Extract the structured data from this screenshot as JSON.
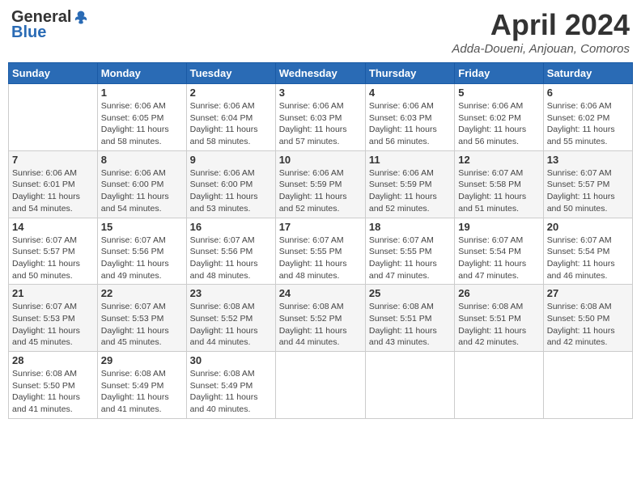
{
  "header": {
    "logo_general": "General",
    "logo_blue": "Blue",
    "title": "April 2024",
    "location": "Adda-Doueni, Anjouan, Comoros"
  },
  "days_of_week": [
    "Sunday",
    "Monday",
    "Tuesday",
    "Wednesday",
    "Thursday",
    "Friday",
    "Saturday"
  ],
  "weeks": [
    [
      {
        "day": "",
        "sunrise": "",
        "sunset": "",
        "daylight": ""
      },
      {
        "day": "1",
        "sunrise": "Sunrise: 6:06 AM",
        "sunset": "Sunset: 6:05 PM",
        "daylight": "Daylight: 11 hours and 58 minutes."
      },
      {
        "day": "2",
        "sunrise": "Sunrise: 6:06 AM",
        "sunset": "Sunset: 6:04 PM",
        "daylight": "Daylight: 11 hours and 58 minutes."
      },
      {
        "day": "3",
        "sunrise": "Sunrise: 6:06 AM",
        "sunset": "Sunset: 6:03 PM",
        "daylight": "Daylight: 11 hours and 57 minutes."
      },
      {
        "day": "4",
        "sunrise": "Sunrise: 6:06 AM",
        "sunset": "Sunset: 6:03 PM",
        "daylight": "Daylight: 11 hours and 56 minutes."
      },
      {
        "day": "5",
        "sunrise": "Sunrise: 6:06 AM",
        "sunset": "Sunset: 6:02 PM",
        "daylight": "Daylight: 11 hours and 56 minutes."
      },
      {
        "day": "6",
        "sunrise": "Sunrise: 6:06 AM",
        "sunset": "Sunset: 6:02 PM",
        "daylight": "Daylight: 11 hours and 55 minutes."
      }
    ],
    [
      {
        "day": "7",
        "sunrise": "Sunrise: 6:06 AM",
        "sunset": "Sunset: 6:01 PM",
        "daylight": "Daylight: 11 hours and 54 minutes."
      },
      {
        "day": "8",
        "sunrise": "Sunrise: 6:06 AM",
        "sunset": "Sunset: 6:00 PM",
        "daylight": "Daylight: 11 hours and 54 minutes."
      },
      {
        "day": "9",
        "sunrise": "Sunrise: 6:06 AM",
        "sunset": "Sunset: 6:00 PM",
        "daylight": "Daylight: 11 hours and 53 minutes."
      },
      {
        "day": "10",
        "sunrise": "Sunrise: 6:06 AM",
        "sunset": "Sunset: 5:59 PM",
        "daylight": "Daylight: 11 hours and 52 minutes."
      },
      {
        "day": "11",
        "sunrise": "Sunrise: 6:06 AM",
        "sunset": "Sunset: 5:59 PM",
        "daylight": "Daylight: 11 hours and 52 minutes."
      },
      {
        "day": "12",
        "sunrise": "Sunrise: 6:07 AM",
        "sunset": "Sunset: 5:58 PM",
        "daylight": "Daylight: 11 hours and 51 minutes."
      },
      {
        "day": "13",
        "sunrise": "Sunrise: 6:07 AM",
        "sunset": "Sunset: 5:57 PM",
        "daylight": "Daylight: 11 hours and 50 minutes."
      }
    ],
    [
      {
        "day": "14",
        "sunrise": "Sunrise: 6:07 AM",
        "sunset": "Sunset: 5:57 PM",
        "daylight": "Daylight: 11 hours and 50 minutes."
      },
      {
        "day": "15",
        "sunrise": "Sunrise: 6:07 AM",
        "sunset": "Sunset: 5:56 PM",
        "daylight": "Daylight: 11 hours and 49 minutes."
      },
      {
        "day": "16",
        "sunrise": "Sunrise: 6:07 AM",
        "sunset": "Sunset: 5:56 PM",
        "daylight": "Daylight: 11 hours and 48 minutes."
      },
      {
        "day": "17",
        "sunrise": "Sunrise: 6:07 AM",
        "sunset": "Sunset: 5:55 PM",
        "daylight": "Daylight: 11 hours and 48 minutes."
      },
      {
        "day": "18",
        "sunrise": "Sunrise: 6:07 AM",
        "sunset": "Sunset: 5:55 PM",
        "daylight": "Daylight: 11 hours and 47 minutes."
      },
      {
        "day": "19",
        "sunrise": "Sunrise: 6:07 AM",
        "sunset": "Sunset: 5:54 PM",
        "daylight": "Daylight: 11 hours and 47 minutes."
      },
      {
        "day": "20",
        "sunrise": "Sunrise: 6:07 AM",
        "sunset": "Sunset: 5:54 PM",
        "daylight": "Daylight: 11 hours and 46 minutes."
      }
    ],
    [
      {
        "day": "21",
        "sunrise": "Sunrise: 6:07 AM",
        "sunset": "Sunset: 5:53 PM",
        "daylight": "Daylight: 11 hours and 45 minutes."
      },
      {
        "day": "22",
        "sunrise": "Sunrise: 6:07 AM",
        "sunset": "Sunset: 5:53 PM",
        "daylight": "Daylight: 11 hours and 45 minutes."
      },
      {
        "day": "23",
        "sunrise": "Sunrise: 6:08 AM",
        "sunset": "Sunset: 5:52 PM",
        "daylight": "Daylight: 11 hours and 44 minutes."
      },
      {
        "day": "24",
        "sunrise": "Sunrise: 6:08 AM",
        "sunset": "Sunset: 5:52 PM",
        "daylight": "Daylight: 11 hours and 44 minutes."
      },
      {
        "day": "25",
        "sunrise": "Sunrise: 6:08 AM",
        "sunset": "Sunset: 5:51 PM",
        "daylight": "Daylight: 11 hours and 43 minutes."
      },
      {
        "day": "26",
        "sunrise": "Sunrise: 6:08 AM",
        "sunset": "Sunset: 5:51 PM",
        "daylight": "Daylight: 11 hours and 42 minutes."
      },
      {
        "day": "27",
        "sunrise": "Sunrise: 6:08 AM",
        "sunset": "Sunset: 5:50 PM",
        "daylight": "Daylight: 11 hours and 42 minutes."
      }
    ],
    [
      {
        "day": "28",
        "sunrise": "Sunrise: 6:08 AM",
        "sunset": "Sunset: 5:50 PM",
        "daylight": "Daylight: 11 hours and 41 minutes."
      },
      {
        "day": "29",
        "sunrise": "Sunrise: 6:08 AM",
        "sunset": "Sunset: 5:49 PM",
        "daylight": "Daylight: 11 hours and 41 minutes."
      },
      {
        "day": "30",
        "sunrise": "Sunrise: 6:08 AM",
        "sunset": "Sunset: 5:49 PM",
        "daylight": "Daylight: 11 hours and 40 minutes."
      },
      {
        "day": "",
        "sunrise": "",
        "sunset": "",
        "daylight": ""
      },
      {
        "day": "",
        "sunrise": "",
        "sunset": "",
        "daylight": ""
      },
      {
        "day": "",
        "sunrise": "",
        "sunset": "",
        "daylight": ""
      },
      {
        "day": "",
        "sunrise": "",
        "sunset": "",
        "daylight": ""
      }
    ]
  ]
}
